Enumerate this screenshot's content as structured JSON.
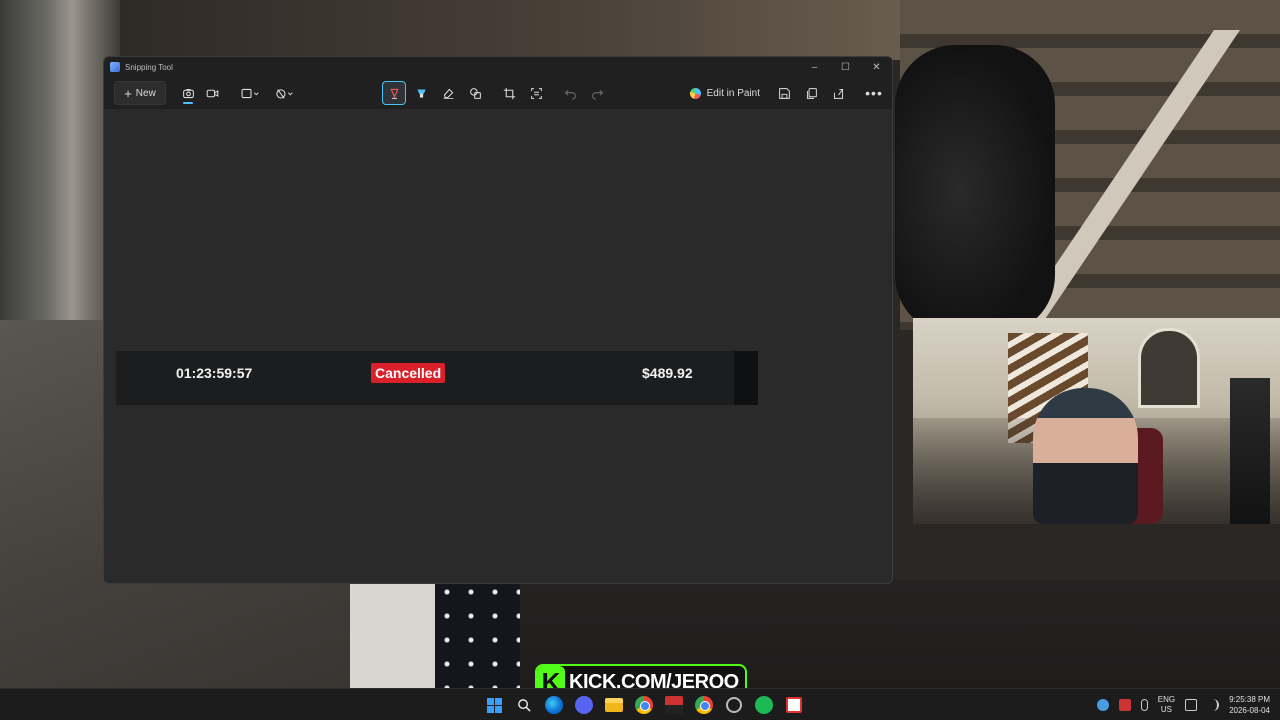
{
  "window": {
    "title": "Snipping Tool",
    "controls": {
      "minimize": "–",
      "maximize": "☐",
      "close": "✕"
    }
  },
  "toolbar": {
    "new_label": "New",
    "edit_in_paint_label": "Edit in Paint",
    "icons": [
      "camera-icon",
      "video-icon",
      "rectangle-mode-icon",
      "timer-icon",
      "ballpoint-pen-icon",
      "highlighter-icon",
      "eraser-icon",
      "shapes-icon",
      "crop-icon",
      "text-actions-icon",
      "undo-icon",
      "redo-icon",
      "save-icon",
      "copy-icon",
      "share-icon",
      "more-options-icon"
    ]
  },
  "snip": {
    "duration": "01:23:59:57",
    "status": "Cancelled",
    "amount": "$489.92",
    "status_color": "#d9202b"
  },
  "overlay": {
    "kick_letter": "K",
    "kick_text": "KICK.COM/JERQO",
    "accent": "#53fc18"
  },
  "taskbar": {
    "apps": [
      "windows-start-icon",
      "search-icon",
      "edge-icon",
      "discord-icon",
      "file-explorer-icon",
      "chrome-icon",
      "app-icon",
      "chrome-icon",
      "clock-app-icon",
      "spotify-icon",
      "snipping-tool-icon"
    ],
    "language": "ENG",
    "region": "US",
    "time": "9:25:38 PM",
    "date": "2026-08-04"
  }
}
